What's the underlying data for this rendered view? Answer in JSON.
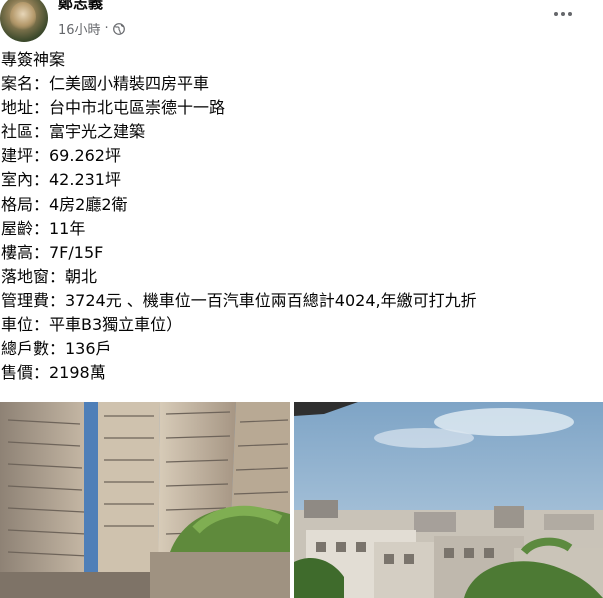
{
  "post": {
    "author": "鄭志義",
    "time": "16小時",
    "separator": "·",
    "lines": [
      "專簽神案",
      "案名：仁美國小精裝四房平車",
      "地址：台中市北屯區崇德十一路",
      "社區：富宇光之建築",
      "建坪：69.262坪",
      "室內：42.231坪",
      "格局：4房2廳2衛",
      "屋齡：11年",
      "樓高：7F/15F",
      "落地窗：朝北",
      "管理費：3724元 、機車位一百汽車位兩百總計4024,年繳可打九折",
      "車位：平車B3獨立車位）",
      "總戶數：136戶",
      "售價：2198萬"
    ]
  },
  "icons": {
    "privacy": "globe-icon",
    "menu": "more-options-icon"
  },
  "colors": {
    "text": "#050505",
    "meta": "#65676b",
    "sky": "#7fa6c9"
  }
}
